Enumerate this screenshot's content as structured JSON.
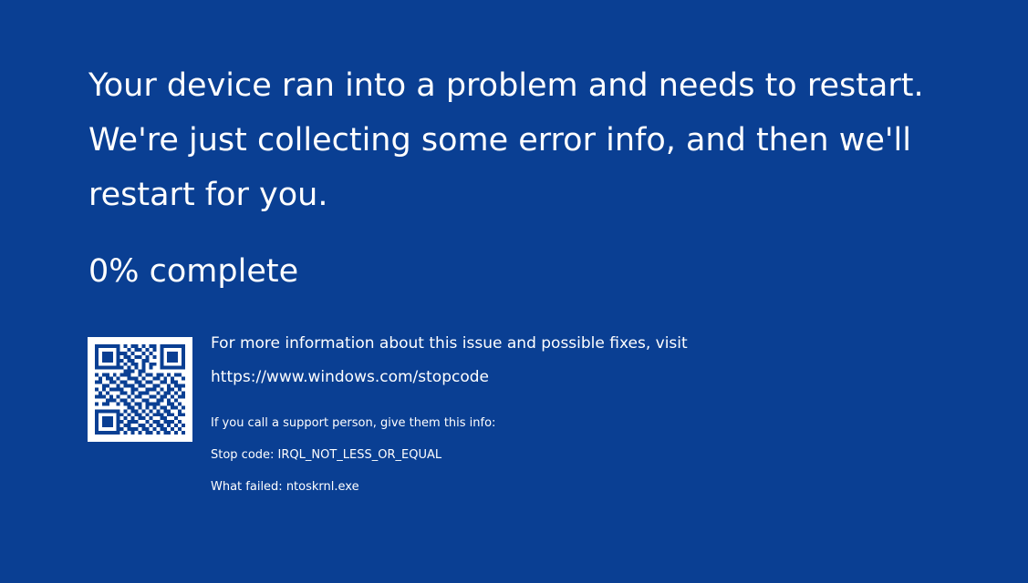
{
  "screen": {
    "headline": [
      "Your device ran into a problem and needs to restart.",
      "We're just collecting some error info, and then we'll",
      "restart for you."
    ],
    "progress_text": "0% complete",
    "progress_fraction": 0
  },
  "info": {
    "more_info": "For more information about this issue and possible fixes, visit",
    "url": "https://www.windows.com/stopcode"
  },
  "support": {
    "intro": "If you call a support person, give them this info:",
    "stop_code": "Stop code: IRQL_NOT_LESS_OR_EQUAL",
    "what_failed": "What failed: ntoskrnl.exe"
  },
  "colors": {
    "background": "#0a3f93",
    "text": "#ffffff",
    "qr_foreground": "#0a3f93",
    "qr_background": "#ffffff"
  },
  "icons": {
    "qr_code": "qr-code-icon"
  }
}
